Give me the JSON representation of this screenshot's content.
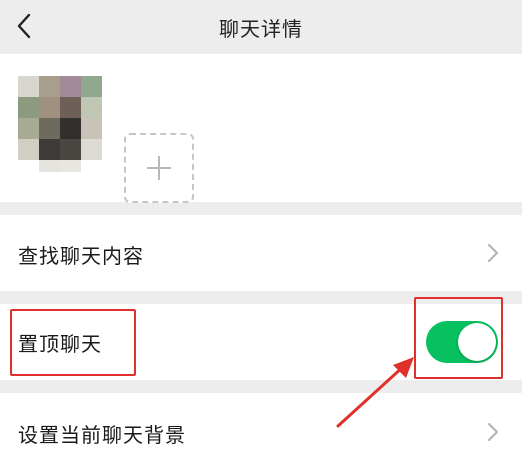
{
  "navbar": {
    "title": "聊天详情",
    "back_icon": "chevron-left-icon"
  },
  "members": {
    "avatar_icon": "pixelated-avatar",
    "add_icon": "plus-icon"
  },
  "rows": [
    {
      "label": "查找聊天内容",
      "trailing": "chevron-right-icon"
    },
    {
      "label": "置顶聊天",
      "trailing": "toggle",
      "toggle_on": true
    },
    {
      "label": "设置当前聊天背景",
      "trailing": "chevron-right-icon"
    }
  ],
  "colors": {
    "background": "#ededed",
    "card": "#ffffff",
    "toggle_on": "#07c160",
    "annotation": "#e0302c"
  }
}
